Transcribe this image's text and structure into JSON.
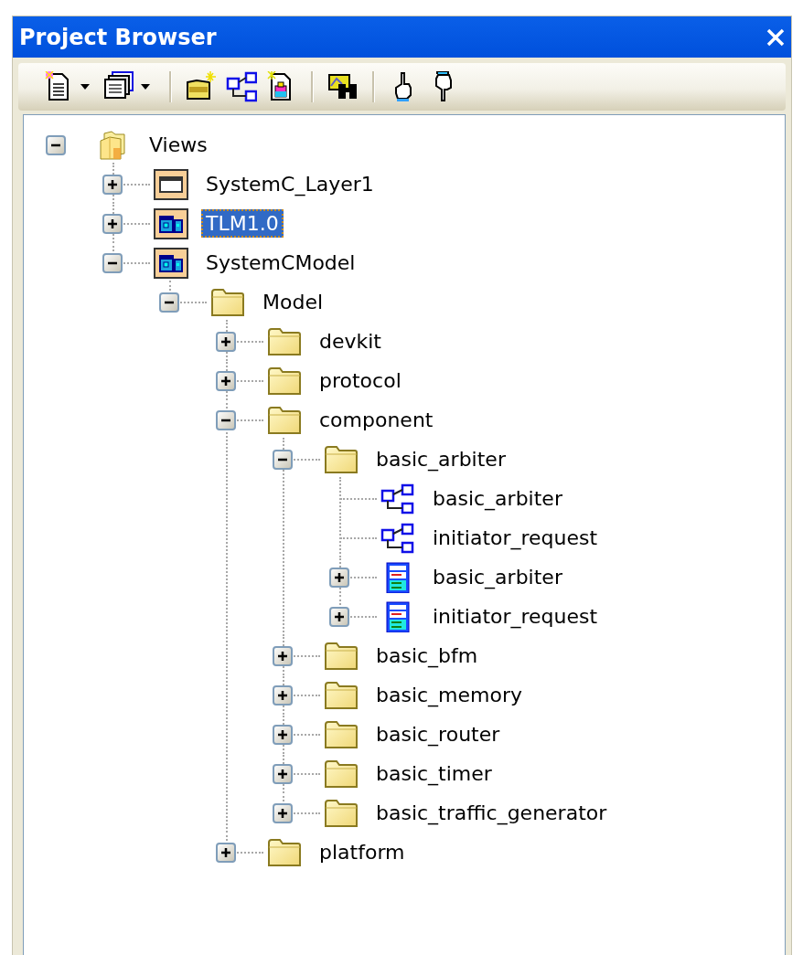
{
  "window": {
    "title": "Project Browser"
  },
  "tree": [
    {
      "label": "Views",
      "kind": "views",
      "expanded": true,
      "selected": false,
      "children": [
        {
          "label": "SystemC_Layer1",
          "kind": "layer",
          "expanded": false,
          "selected": false
        },
        {
          "label": "TLM1.0",
          "kind": "package",
          "expanded": false,
          "selected": true
        },
        {
          "label": "SystemCModel",
          "kind": "package",
          "expanded": true,
          "selected": false,
          "children": [
            {
              "label": "Model",
              "kind": "folder",
              "expanded": true,
              "selected": false,
              "children": [
                {
                  "label": "devkit",
                  "kind": "folder",
                  "expanded": false,
                  "selected": false
                },
                {
                  "label": "protocol",
                  "kind": "folder",
                  "expanded": false,
                  "selected": false
                },
                {
                  "label": "component",
                  "kind": "folder",
                  "expanded": true,
                  "selected": false,
                  "children": [
                    {
                      "label": "basic_arbiter",
                      "kind": "folder",
                      "expanded": true,
                      "selected": false,
                      "children": [
                        {
                          "label": "basic_arbiter",
                          "kind": "diagram",
                          "selected": false
                        },
                        {
                          "label": "initiator_request",
                          "kind": "diagram",
                          "selected": false
                        },
                        {
                          "label": "basic_arbiter",
                          "kind": "record",
                          "expanded": false,
                          "selected": false
                        },
                        {
                          "label": "initiator_request",
                          "kind": "record",
                          "expanded": false,
                          "selected": false
                        }
                      ]
                    },
                    {
                      "label": "basic_bfm",
                      "kind": "folder",
                      "expanded": false,
                      "selected": false
                    },
                    {
                      "label": "basic_memory",
                      "kind": "folder",
                      "expanded": false,
                      "selected": false
                    },
                    {
                      "label": "basic_router",
                      "kind": "folder",
                      "expanded": false,
                      "selected": false
                    },
                    {
                      "label": "basic_timer",
                      "kind": "folder",
                      "expanded": false,
                      "selected": false
                    },
                    {
                      "label": "basic_traffic_generator",
                      "kind": "folder",
                      "expanded": false,
                      "selected": false
                    }
                  ]
                },
                {
                  "label": "platform",
                  "kind": "folder",
                  "expanded": false,
                  "selected": false
                }
              ]
            }
          ]
        }
      ]
    }
  ]
}
